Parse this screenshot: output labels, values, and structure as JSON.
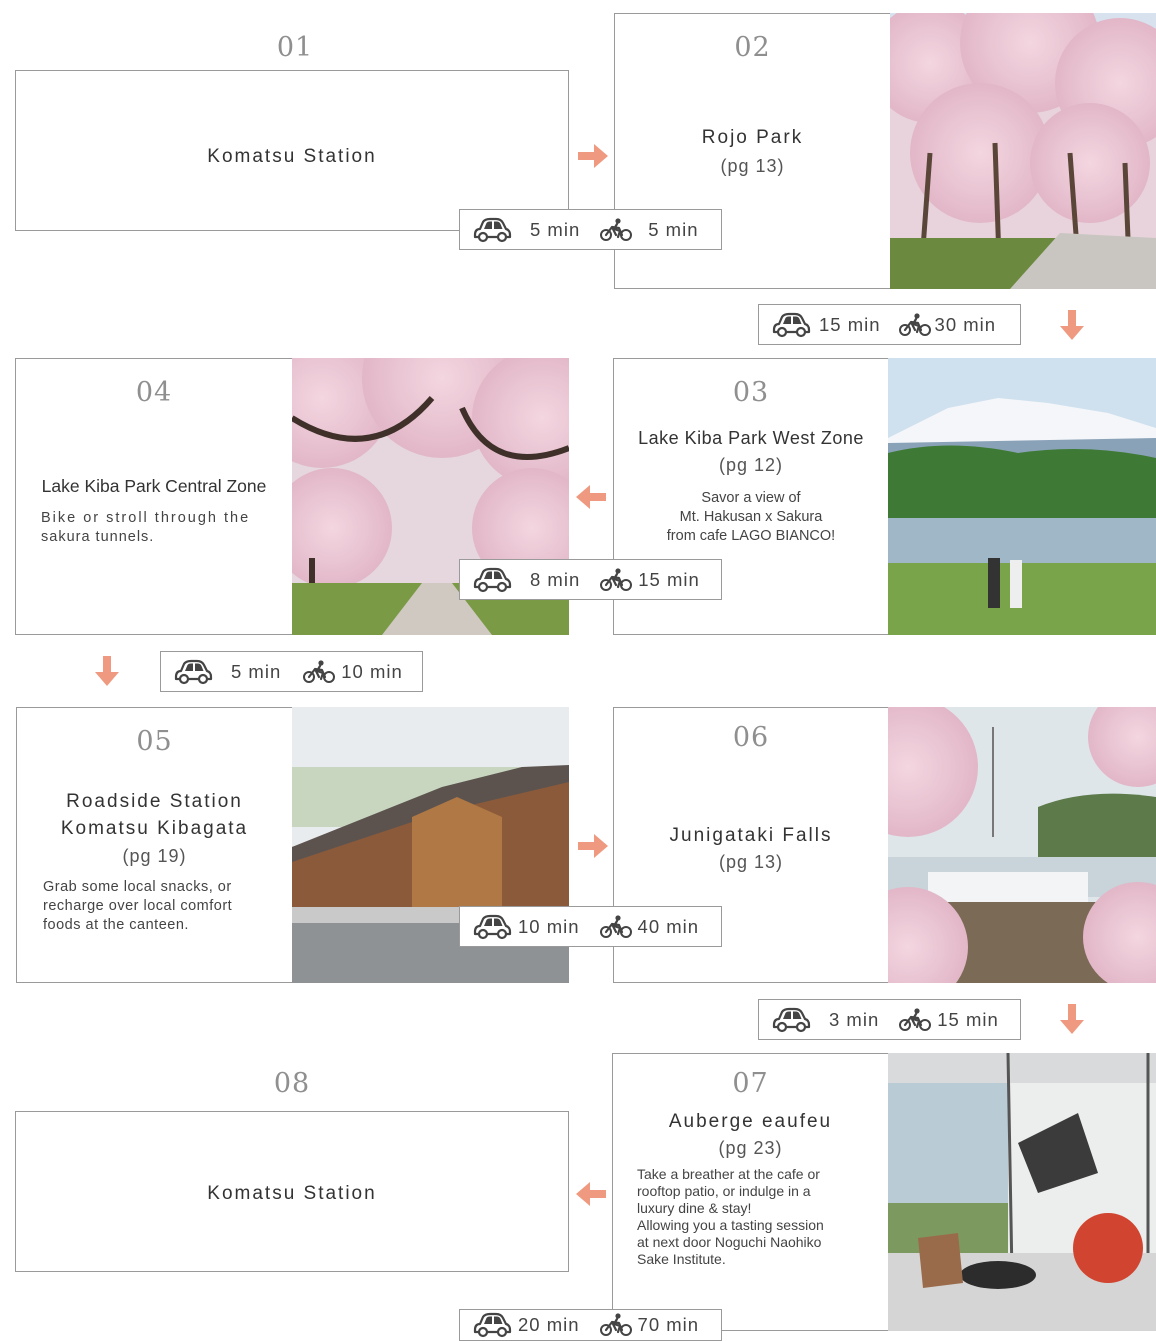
{
  "colors": {
    "arrow": "#ef9a80",
    "border": "#9a9a9a",
    "number": "#8f8f8f"
  },
  "stops": [
    {
      "num": "01",
      "title": "Komatsu Station"
    },
    {
      "num": "02",
      "title": "Rojo Park",
      "pg": "(pg 13)",
      "photo": "cherry-blossom-park-photo"
    },
    {
      "num": "03",
      "title": "Lake Kiba Park West Zone",
      "pg": "(pg 12)",
      "desc_lines": [
        "Savor a view of",
        "Mt. Hakusan x Sakura",
        "from cafe LAGO BIANCO!"
      ],
      "photo": "lake-mountain-photo"
    },
    {
      "num": "04",
      "title": "Lake Kiba Park Central Zone",
      "desc_lines": [
        "Bike or stroll through the",
        "sakura tunnels."
      ],
      "photo": "sakura-tunnel-photo"
    },
    {
      "num": "05",
      "title_lines": [
        "Roadside Station",
        "Komatsu Kibagata"
      ],
      "pg": "(pg 19)",
      "desc_lines": [
        "Grab some local snacks, or",
        "recharge over local comfort",
        "foods at the canteen."
      ],
      "photo": "roadside-station-photo"
    },
    {
      "num": "06",
      "title": "Junigataki Falls",
      "pg": "(pg 13)",
      "photo": "waterfall-sakura-photo"
    },
    {
      "num": "07",
      "title": "Auberge eaufeu",
      "pg": "(pg 23)",
      "desc_lines": [
        "Take a breather at the cafe or",
        "rooftop patio, or indulge in a",
        "luxury dine & stay!",
        "Allowing you a tasting session",
        "at next door Noguchi Naohiko",
        "Sake Institute."
      ],
      "photo": "cafe-interior-photo"
    },
    {
      "num": "08",
      "title": "Komatsu Station"
    }
  ],
  "travel": [
    {
      "car": "5 min",
      "bike": "5 min"
    },
    {
      "car": "15 min",
      "bike": "30 min"
    },
    {
      "car": "8 min",
      "bike": "15 min"
    },
    {
      "car": "5 min",
      "bike": "10 min"
    },
    {
      "car": "10 min",
      "bike": "40 min"
    },
    {
      "car": "3 min",
      "bike": "15 min"
    },
    {
      "car": "20 min",
      "bike": "70 min"
    }
  ],
  "icons": {
    "car": "car-icon",
    "bike": "bicycle-icon",
    "arrow": "arrow-icon"
  }
}
